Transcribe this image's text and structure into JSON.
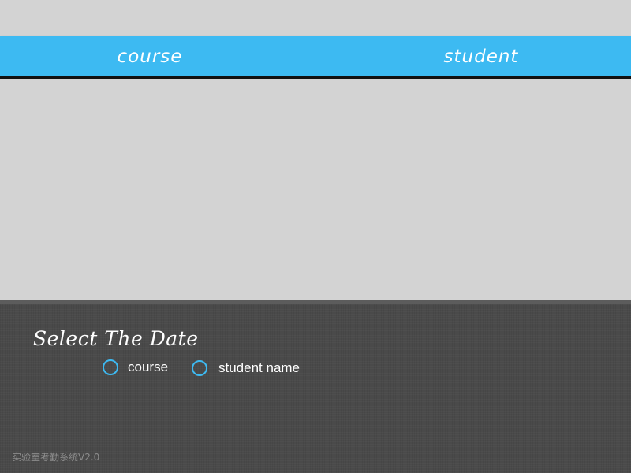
{
  "tabs": [
    {
      "label": "course"
    },
    {
      "label": "student"
    }
  ],
  "panel": {
    "title": "Select The Date",
    "options": [
      {
        "label": "course",
        "selected": false
      },
      {
        "label": "student name",
        "selected": false
      }
    ]
  },
  "footer": {
    "version": "实验室考勤系统V2.0"
  },
  "colors": {
    "accent": "#3dbaf2",
    "background": "#d3d3d3",
    "panel": "#4a4a4a"
  }
}
